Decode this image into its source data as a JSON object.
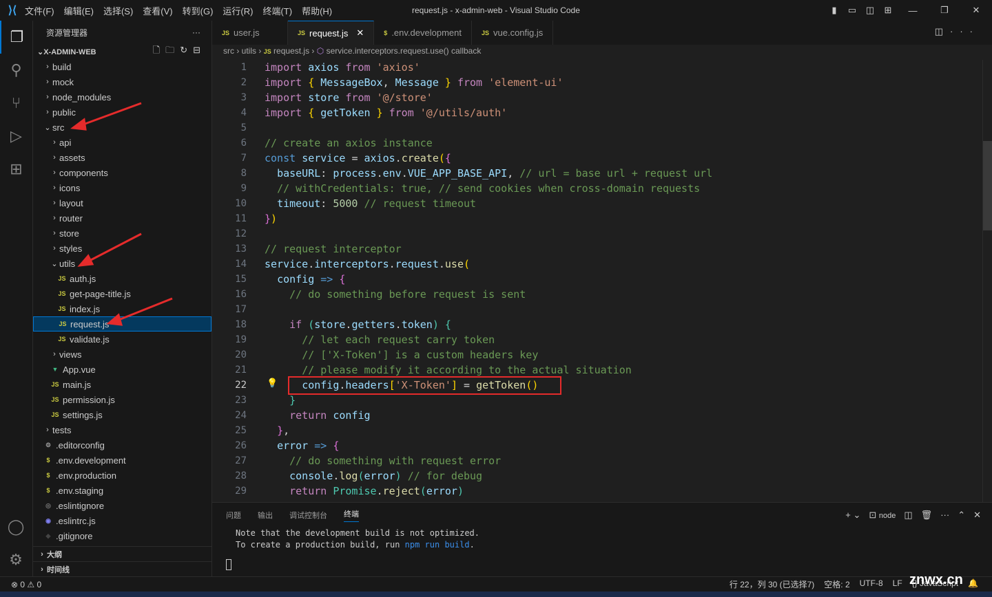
{
  "titlebar": {
    "menu": [
      "文件(F)",
      "编辑(E)",
      "选择(S)",
      "查看(V)",
      "转到(G)",
      "运行(R)",
      "终端(T)",
      "帮助(H)"
    ],
    "title": "request.js - x-admin-web - Visual Studio Code"
  },
  "sidebar": {
    "title": "资源管理器",
    "more": "···",
    "project": "X-ADMIN-WEB",
    "items": [
      {
        "label": "build",
        "depth": 0,
        "type": "folder",
        "open": false
      },
      {
        "label": "mock",
        "depth": 0,
        "type": "folder",
        "open": false
      },
      {
        "label": "node_modules",
        "depth": 0,
        "type": "folder",
        "open": false
      },
      {
        "label": "public",
        "depth": 0,
        "type": "folder",
        "open": false
      },
      {
        "label": "src",
        "depth": 0,
        "type": "folder",
        "open": true
      },
      {
        "label": "api",
        "depth": 1,
        "type": "folder",
        "open": false
      },
      {
        "label": "assets",
        "depth": 1,
        "type": "folder",
        "open": false
      },
      {
        "label": "components",
        "depth": 1,
        "type": "folder",
        "open": false
      },
      {
        "label": "icons",
        "depth": 1,
        "type": "folder",
        "open": false
      },
      {
        "label": "layout",
        "depth": 1,
        "type": "folder",
        "open": false
      },
      {
        "label": "router",
        "depth": 1,
        "type": "folder",
        "open": false
      },
      {
        "label": "store",
        "depth": 1,
        "type": "folder",
        "open": false
      },
      {
        "label": "styles",
        "depth": 1,
        "type": "folder",
        "open": false
      },
      {
        "label": "utils",
        "depth": 1,
        "type": "folder",
        "open": true
      },
      {
        "label": "auth.js",
        "depth": 2,
        "type": "js"
      },
      {
        "label": "get-page-title.js",
        "depth": 2,
        "type": "js"
      },
      {
        "label": "index.js",
        "depth": 2,
        "type": "js"
      },
      {
        "label": "request.js",
        "depth": 2,
        "type": "js",
        "selected": true
      },
      {
        "label": "validate.js",
        "depth": 2,
        "type": "js"
      },
      {
        "label": "views",
        "depth": 1,
        "type": "folder",
        "open": false
      },
      {
        "label": "App.vue",
        "depth": 1,
        "type": "vue"
      },
      {
        "label": "main.js",
        "depth": 1,
        "type": "js"
      },
      {
        "label": "permission.js",
        "depth": 1,
        "type": "js"
      },
      {
        "label": "settings.js",
        "depth": 1,
        "type": "js"
      },
      {
        "label": "tests",
        "depth": 0,
        "type": "folder",
        "open": false
      },
      {
        "label": ".editorconfig",
        "depth": 0,
        "type": "gear"
      },
      {
        "label": ".env.development",
        "depth": 0,
        "type": "env"
      },
      {
        "label": ".env.production",
        "depth": 0,
        "type": "env"
      },
      {
        "label": ".env.staging",
        "depth": 0,
        "type": "env"
      },
      {
        "label": ".eslintignore",
        "depth": 0,
        "type": "circle"
      },
      {
        "label": ".eslintrc.js",
        "depth": 0,
        "type": "eslint"
      },
      {
        "label": ".gitignore",
        "depth": 0,
        "type": "git"
      }
    ],
    "outline": "大纲",
    "timeline": "时间线"
  },
  "tabs": [
    {
      "label": "user.js",
      "icon": "JS"
    },
    {
      "label": "request.js",
      "icon": "JS",
      "active": true
    },
    {
      "label": ".env.development",
      "icon": "$"
    },
    {
      "label": "vue.config.js",
      "icon": "JS"
    }
  ],
  "breadcrumb": [
    "src",
    "utils",
    "request.js",
    "service.interceptors.request.use() callback"
  ],
  "editor": {
    "current_line": 22,
    "lines": [
      [
        [
          "k",
          "import "
        ],
        [
          "v",
          "axios "
        ],
        [
          "k",
          "from "
        ],
        [
          "s",
          "'axios'"
        ]
      ],
      [
        [
          "k",
          "import "
        ],
        [
          "y",
          "{ "
        ],
        [
          "v",
          "MessageBox"
        ],
        [
          "p",
          ", "
        ],
        [
          "v",
          "Message "
        ],
        [
          "y",
          "} "
        ],
        [
          "k",
          "from "
        ],
        [
          "s",
          "'element-ui'"
        ]
      ],
      [
        [
          "k",
          "import "
        ],
        [
          "v",
          "store "
        ],
        [
          "k",
          "from "
        ],
        [
          "s",
          "'@/store'"
        ]
      ],
      [
        [
          "k",
          "import "
        ],
        [
          "y",
          "{ "
        ],
        [
          "v",
          "getToken "
        ],
        [
          "y",
          "} "
        ],
        [
          "k",
          "from "
        ],
        [
          "s",
          "'@/utils/auth'"
        ]
      ],
      [],
      [
        [
          "c",
          "// create an axios instance"
        ]
      ],
      [
        [
          "b",
          "const "
        ],
        [
          "v",
          "service "
        ],
        [
          "p",
          "= "
        ],
        [
          "v",
          "axios"
        ],
        [
          "p",
          "."
        ],
        [
          "f",
          "create"
        ],
        [
          "y",
          "("
        ],
        [
          "m",
          "{"
        ]
      ],
      [
        [
          "p",
          "  "
        ],
        [
          "v",
          "baseURL"
        ],
        [
          "p",
          ": "
        ],
        [
          "v",
          "process"
        ],
        [
          "p",
          "."
        ],
        [
          "v",
          "env"
        ],
        [
          "p",
          "."
        ],
        [
          "v",
          "VUE_APP_BASE_API"
        ],
        [
          "p",
          ", "
        ],
        [
          "c",
          "// url = base url + request url"
        ]
      ],
      [
        [
          "p",
          "  "
        ],
        [
          "c",
          "// withCredentials: true, // send cookies when cross-domain requests"
        ]
      ],
      [
        [
          "p",
          "  "
        ],
        [
          "v",
          "timeout"
        ],
        [
          "p",
          ": "
        ],
        [
          "n",
          "5000 "
        ],
        [
          "c",
          "// request timeout"
        ]
      ],
      [
        [
          "m",
          "}"
        ],
        [
          "y",
          ")"
        ]
      ],
      [],
      [
        [
          "c",
          "// request interceptor"
        ]
      ],
      [
        [
          "v",
          "service"
        ],
        [
          "p",
          "."
        ],
        [
          "v",
          "interceptors"
        ],
        [
          "p",
          "."
        ],
        [
          "v",
          "request"
        ],
        [
          "p",
          "."
        ],
        [
          "f",
          "use"
        ],
        [
          "y",
          "("
        ]
      ],
      [
        [
          "p",
          "  "
        ],
        [
          "v",
          "config "
        ],
        [
          "b",
          "=> "
        ],
        [
          "m",
          "{"
        ]
      ],
      [
        [
          "p",
          "    "
        ],
        [
          "c",
          "// do something before request is sent"
        ]
      ],
      [],
      [
        [
          "p",
          "    "
        ],
        [
          "k",
          "if "
        ],
        [
          "o",
          "("
        ],
        [
          "v",
          "store"
        ],
        [
          "p",
          "."
        ],
        [
          "v",
          "getters"
        ],
        [
          "p",
          "."
        ],
        [
          "v",
          "token"
        ],
        [
          "o",
          ") "
        ],
        [
          "o",
          "{"
        ]
      ],
      [
        [
          "p",
          "      "
        ],
        [
          "c",
          "// let each request carry token"
        ]
      ],
      [
        [
          "p",
          "      "
        ],
        [
          "c",
          "// ['X-Token'] is a custom headers key"
        ]
      ],
      [
        [
          "p",
          "      "
        ],
        [
          "c",
          "// please modify it according to the actual situation"
        ]
      ],
      [
        [
          "p",
          "      "
        ],
        [
          "v",
          "config"
        ],
        [
          "p",
          "."
        ],
        [
          "v",
          "headers"
        ],
        [
          "y",
          "["
        ],
        [
          "s",
          "'X-Token'"
        ],
        [
          "y",
          "] "
        ],
        [
          "p",
          "= "
        ],
        [
          "f",
          "getToken"
        ],
        [
          "y",
          "()"
        ]
      ],
      [
        [
          "p",
          "    "
        ],
        [
          "o",
          "}"
        ]
      ],
      [
        [
          "p",
          "    "
        ],
        [
          "k",
          "return "
        ],
        [
          "v",
          "config"
        ]
      ],
      [
        [
          "p",
          "  "
        ],
        [
          "m",
          "}"
        ],
        [
          "p",
          ","
        ]
      ],
      [
        [
          "p",
          "  "
        ],
        [
          "v",
          "error "
        ],
        [
          "b",
          "=> "
        ],
        [
          "m",
          "{"
        ]
      ],
      [
        [
          "p",
          "    "
        ],
        [
          "c",
          "// do something with request error"
        ]
      ],
      [
        [
          "p",
          "    "
        ],
        [
          "v",
          "console"
        ],
        [
          "p",
          "."
        ],
        [
          "f",
          "log"
        ],
        [
          "o",
          "("
        ],
        [
          "v",
          "error"
        ],
        [
          "o",
          ") "
        ],
        [
          "c",
          "// for debug"
        ]
      ],
      [
        [
          "p",
          "    "
        ],
        [
          "k",
          "return "
        ],
        [
          "o",
          "Promise"
        ],
        [
          "p",
          "."
        ],
        [
          "f",
          "reject"
        ],
        [
          "o",
          "("
        ],
        [
          "v",
          "error"
        ],
        [
          "o",
          ")"
        ]
      ]
    ]
  },
  "panel": {
    "tabs": [
      "问题",
      "输出",
      "调试控制台",
      "终端"
    ],
    "active": "终端",
    "shell": "node",
    "line1": "Note that the development build is not optimized.",
    "line2_pre": "To create a production build, run ",
    "line2_cmd": "npm run build",
    "line2_post": "."
  },
  "status": {
    "errors": "0",
    "warnings": "0",
    "position": "行 22，列 30 (已选择7)",
    "spaces": "空格: 2",
    "encoding": "UTF-8",
    "eol": "LF",
    "language": "JavaScript"
  },
  "watermark": "znwx.cn"
}
